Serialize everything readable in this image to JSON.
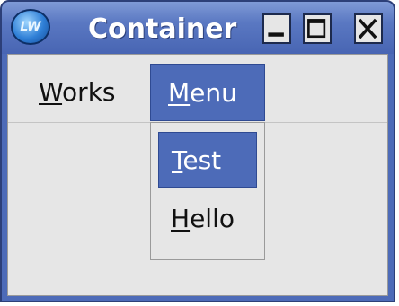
{
  "window": {
    "title": "Container",
    "logo_text": "LW",
    "icons": {
      "minimize": "minimize-icon",
      "maximize": "maximize-icon",
      "close": "close-icon"
    }
  },
  "menubar": {
    "items": [
      {
        "mnemonic": "W",
        "rest": "orks"
      },
      {
        "mnemonic": "M",
        "rest": "enu",
        "selected": true
      }
    ]
  },
  "dropdown": {
    "items": [
      {
        "mnemonic": "T",
        "rest": "est",
        "selected": true
      },
      {
        "mnemonic": "H",
        "rest": "ello"
      }
    ]
  },
  "colors": {
    "selection": "#4d6bb8",
    "title_bar": "#5a78c2",
    "window_bg": "#e6e6e6"
  }
}
